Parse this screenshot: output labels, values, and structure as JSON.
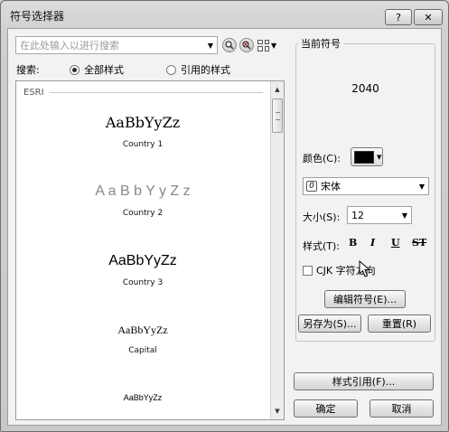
{
  "window": {
    "title": "符号选择器"
  },
  "titlebar": {
    "help_label": "?",
    "close_label": "✕"
  },
  "search": {
    "placeholder": "在此处输入以进行搜索",
    "dropdown_icon": "chevron-down-icon"
  },
  "toolbar": {
    "search_icon": "magnifier-icon",
    "clear_icon": "clear-search-icon",
    "view_icon": "grid-view-icon"
  },
  "filter": {
    "label": "搜索:",
    "options": [
      {
        "label": "全部样式",
        "selected": true
      },
      {
        "label": "引用的样式",
        "selected": false
      }
    ]
  },
  "gallery": {
    "group_name": "ESRI",
    "symbols": [
      {
        "sample": "AaBbYyZz",
        "name": "Country 1"
      },
      {
        "sample": "A a B b Y y Z z",
        "name": "Country 2"
      },
      {
        "sample": "AaBbYyZz",
        "name": "Country 3"
      },
      {
        "sample": "AaBbYyZz",
        "name": "Capital"
      },
      {
        "sample": "AaBbYyZz",
        "name": ""
      }
    ]
  },
  "current": {
    "section_title": "当前符号",
    "preview_value": "2040",
    "color_label": "颜色(C):",
    "color_value": "#000000",
    "font_icon": "opentype-font-icon",
    "font_value": "宋体",
    "size_label": "大小(S):",
    "size_value": "12",
    "style_label": "样式(T):",
    "style_bold": "B",
    "style_italic": "I",
    "style_underline": "U",
    "style_strike": "ST",
    "cjk_label": "CJK 字符方向",
    "cjk_checked": false,
    "edit_button": "编辑符号(E)...",
    "save_as_button": "另存为(S)...",
    "reset_button": "重置(R)"
  },
  "footer": {
    "style_ref_button": "样式引用(F)...",
    "ok_button": "确定",
    "cancel_button": "取消"
  }
}
